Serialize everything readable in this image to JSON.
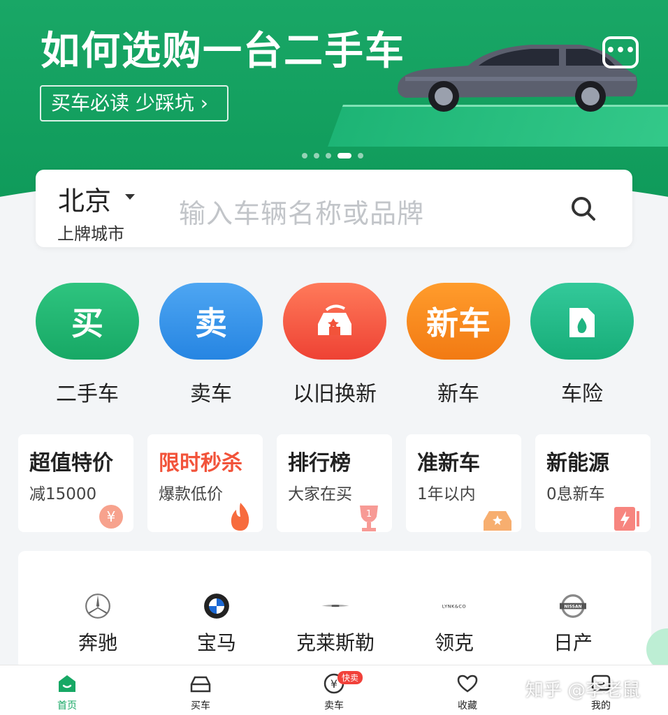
{
  "banner": {
    "title": "如何选购一台二手车",
    "subtitle": "买车必读 少踩坑 ›",
    "chat_icon": "chat-bubble-icon",
    "dots_count": 5,
    "active_dot": 3
  },
  "search": {
    "city": "北京",
    "city_sub": "上牌城市",
    "placeholder": "输入车辆名称或品牌"
  },
  "main_icons": [
    {
      "glyph": "买",
      "label": "二手车",
      "color": "#20b36d"
    },
    {
      "glyph": "卖",
      "label": "卖车",
      "color": "#2d8fe6"
    },
    {
      "glyph": "",
      "label": "以旧换新",
      "color": "#f2533a"
    },
    {
      "glyph": "新车",
      "label": "新车",
      "color": "#f5861f"
    },
    {
      "glyph": "",
      "label": "车险",
      "color": "#1fb480"
    }
  ],
  "feature_cards": [
    {
      "title": "超值特价",
      "sub": "减15000",
      "red": false
    },
    {
      "title": "限时秒杀",
      "sub": "爆款低价",
      "red": true
    },
    {
      "title": "排行榜",
      "sub": "大家在买",
      "red": false
    },
    {
      "title": "准新车",
      "sub": "1年以内",
      "red": false
    },
    {
      "title": "新能源",
      "sub": "0息新车",
      "red": false
    }
  ],
  "brands": [
    {
      "name": "奔驰",
      "logo": "mercedes-logo"
    },
    {
      "name": "宝马",
      "logo": "bmw-logo"
    },
    {
      "name": "克莱斯勒",
      "logo": "chrysler-logo"
    },
    {
      "name": "领克",
      "logo": "lynkco-logo"
    },
    {
      "name": "日产",
      "logo": "nissan-logo"
    }
  ],
  "brand_logo_text": {
    "lynkco": "LYNK&CO",
    "nissan": "NISSAN"
  },
  "bottom_nav": [
    {
      "label": "首页",
      "active": true
    },
    {
      "label": "买车",
      "active": false
    },
    {
      "label": "卖车",
      "active": false,
      "badge": "快卖"
    },
    {
      "label": "收藏",
      "active": false
    },
    {
      "label": "我的",
      "active": false
    }
  ],
  "watermark": "知乎 @李老鼠",
  "colors": {
    "brand_green": "#17a865",
    "badge_red": "#f1413a"
  }
}
